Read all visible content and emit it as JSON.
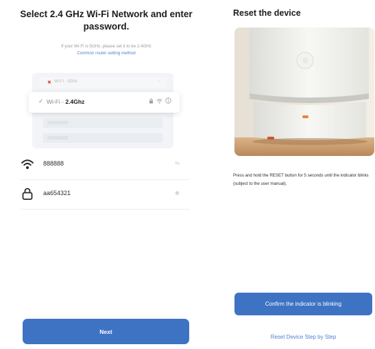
{
  "wifi_screen": {
    "title": "Select 2.4 GHz Wi-Fi Network and enter password.",
    "hint": "If your Wi-Fi is 5GHz, please set it to be 2.4GHz",
    "hint_link": "Common router setting method",
    "illustration": {
      "network_5g": "Wi-Fi - 5Ghz",
      "network_24_prefix": "Wi-Fi - ",
      "network_24_band": "2.4Ghz"
    },
    "ssid_field": {
      "value": "888888",
      "icon": "wifi-icon",
      "trailing_icon": "switch-network-icon"
    },
    "password_field": {
      "value": "aa654321",
      "icon": "lock-icon",
      "trailing_icon": "eye-icon"
    },
    "next_label": "Next"
  },
  "reset_screen": {
    "title": "Reset the device",
    "instructions": "Press and hold the RESET button for 5 seconds until the indicator blinks (subject to the user manual).",
    "confirm_label": "Confirm the indicator is blinking",
    "step_link": "Reset Device Step by Step"
  },
  "colors": {
    "primary": "#3e73c4",
    "link": "#4f7fd1",
    "indicator": "#e8833a",
    "warning_dot": "#e0474c"
  }
}
